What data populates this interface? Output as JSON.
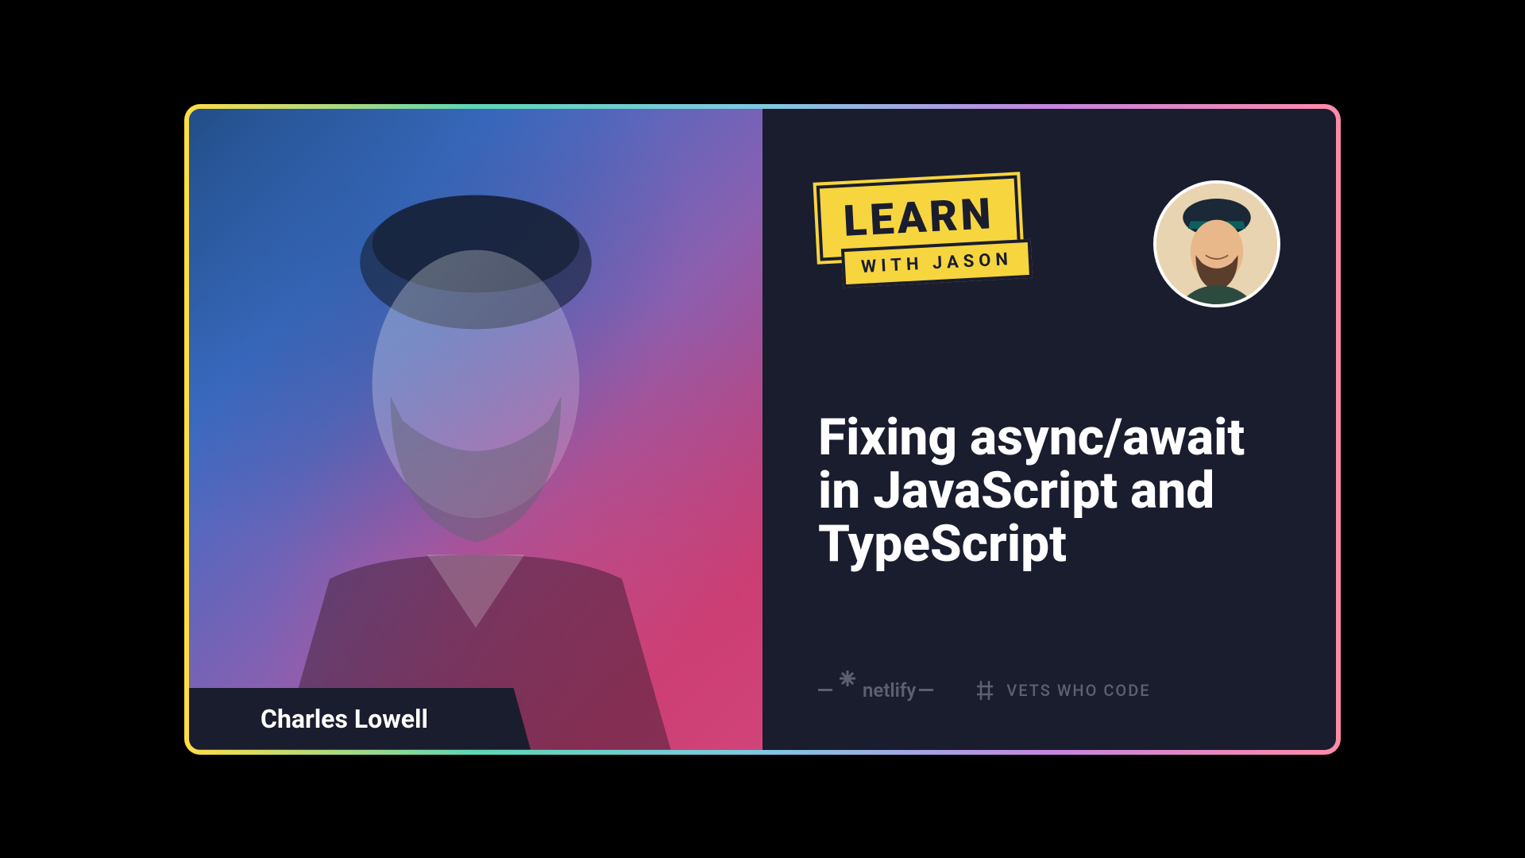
{
  "guest": {
    "name": "Charles Lowell"
  },
  "logo": {
    "line1": "LEARN",
    "line2": "WITH JASON"
  },
  "episode": {
    "title": "Fixing async/await in JavaScript and TypeScript"
  },
  "sponsors": {
    "netlify": "netlify",
    "vwc": "VETS WHO CODE"
  }
}
